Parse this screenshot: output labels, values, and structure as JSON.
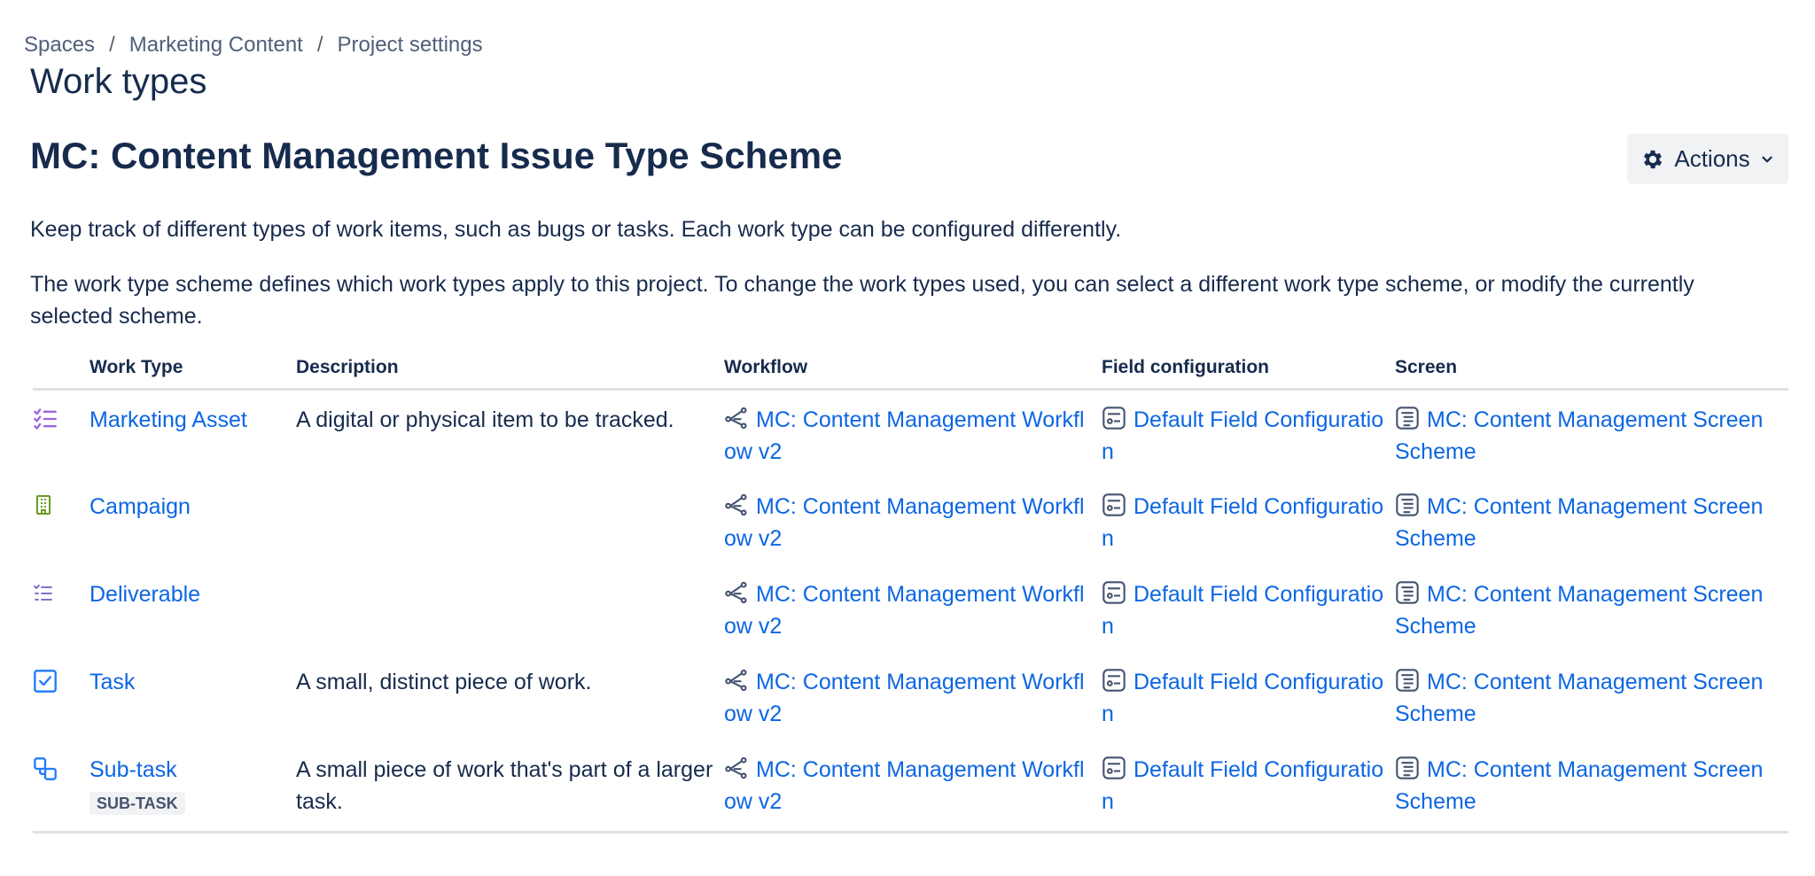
{
  "breadcrumb": [
    "Spaces",
    "Marketing Content",
    "Project settings"
  ],
  "breadcrumb_separator": "/",
  "page_title": "Work types",
  "scheme_title": "MC: Content Management Issue Type Scheme",
  "actions_label": "Actions",
  "description_1": "Keep track of different types of work items, such as bugs or tasks. Each work type can be configured differently.",
  "description_2": "The work type scheme defines which work types apply to this project. To change the work types used, you can select a different work type scheme, or modify the currently selected scheme.",
  "table": {
    "headers": {
      "work_type": "Work Type",
      "description": "Description",
      "workflow": "Workflow",
      "field_configuration": "Field configuration",
      "screen": "Screen"
    },
    "rows": [
      {
        "icon": "checklist-icon",
        "icon_color": "#9f63df",
        "name": "Marketing Asset",
        "description": "A digital or physical item to be tracked.",
        "workflow": "MC: Content Management Workflow v2",
        "field_configuration": "Default Field Configuration",
        "screen": "MC: Content Management Screen Scheme"
      },
      {
        "icon": "building-icon",
        "icon_color": "#6a9a23",
        "name": "Campaign",
        "description": "",
        "workflow": "MC: Content Management Workflow v2",
        "field_configuration": "Default Field Configuration",
        "screen": "MC: Content Management Screen Scheme"
      },
      {
        "icon": "list-icon",
        "icon_color": "#6e5dc6",
        "name": "Deliverable",
        "description": "",
        "workflow": "MC: Content Management Workflow v2",
        "field_configuration": "Default Field Configuration",
        "screen": "MC: Content Management Screen Scheme"
      },
      {
        "icon": "checkbox-icon",
        "icon_color": "#1d7afc",
        "name": "Task",
        "description": "A small, distinct piece of work.",
        "workflow": "MC: Content Management Workflow v2",
        "field_configuration": "Default Field Configuration",
        "screen": "MC: Content Management Screen Scheme"
      },
      {
        "icon": "subtask-icon",
        "icon_color": "#1d7afc",
        "name": "Sub-task",
        "lozenge": "SUB-TASK",
        "description": "A small piece of work that's part of a larger task.",
        "workflow": "MC: Content Management Workflow v2",
        "field_configuration": "Default Field Configuration",
        "screen": "MC: Content Management Screen Scheme"
      }
    ]
  },
  "colors": {
    "link": "#0c66e4",
    "text": "#172b4d",
    "subtle_text": "#505f79",
    "button_bg": "#f1f2f4",
    "divider": "#dfe1e6"
  }
}
